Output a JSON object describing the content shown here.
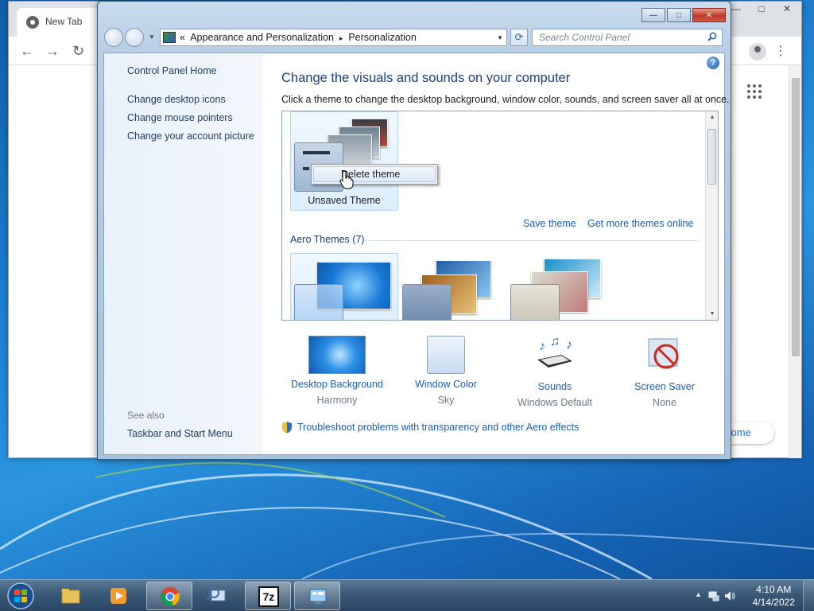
{
  "browser": {
    "tab_title": "New Tab",
    "pill_text": "hrome",
    "icons": [
      "chrome-logo-icon",
      "back-arrow-icon",
      "forward-arrow-icon",
      "reload-icon",
      "profile-icon",
      "menu-dots-icon",
      "apps-grid-icon"
    ]
  },
  "window": {
    "controls": {
      "minimize": "—",
      "maximize": "□",
      "close": "✕"
    }
  },
  "address": {
    "prefix": "«",
    "crumbs": [
      "Appearance and Personalization",
      "Personalization"
    ],
    "separator": "▸",
    "dropdown": "▼",
    "refresh": "⟳"
  },
  "search": {
    "placeholder": "Search Control Panel"
  },
  "help_label": "?",
  "left_pane": {
    "home": "Control Panel Home",
    "links": [
      "Change desktop icons",
      "Change mouse pointers",
      "Change your account picture"
    ],
    "see_also_title": "See also",
    "see_also_links": [
      "Taskbar and Start Menu"
    ]
  },
  "main": {
    "title": "Change the visuals and sounds on your computer",
    "description": "Click a theme to change the desktop background, window color, sounds, and screen saver all at once.",
    "unsaved_theme": "Unsaved Theme",
    "context_menu": {
      "item": "Delete theme"
    },
    "save_theme": "Save theme",
    "more_themes": "Get more themes online",
    "aero_group": "Aero Themes (7)",
    "scroll_up": "▲",
    "scroll_down": "▼"
  },
  "settings": [
    {
      "label": "Desktop Background",
      "value": "Harmony",
      "icon": "desktop-background-icon"
    },
    {
      "label": "Window Color",
      "value": "Sky",
      "icon": "window-color-icon"
    },
    {
      "label": "Sounds",
      "value": "Windows Default",
      "icon": "sounds-icon"
    },
    {
      "label": "Screen Saver",
      "value": "None",
      "icon": "screen-saver-icon"
    }
  ],
  "troubleshoot": "Troubleshoot problems with transparency and other Aero effects",
  "taskbar": {
    "items": [
      "explorer",
      "media-player",
      "chrome",
      "control-panel-search",
      "7zip",
      "control-panel"
    ],
    "sevenzip_label": "7z",
    "tray_arrow": "▲",
    "time": "4:10 AM",
    "date": "4/14/2022"
  },
  "colors": {
    "accent_link": "#1d5fb3",
    "title_blue": "#1e3e7a",
    "desktop": "#1d7fd0"
  }
}
